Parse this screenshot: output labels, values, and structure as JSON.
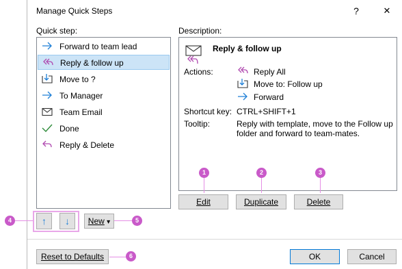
{
  "window": {
    "title": "Manage Quick Steps",
    "help_glyph": "?",
    "close_glyph": "✕"
  },
  "left": {
    "label": "Quick step:",
    "items": [
      {
        "label": "Forward to team lead",
        "icon": "forward-arrow-icon"
      },
      {
        "label": "Reply & follow up",
        "icon": "reply-all-icon",
        "selected": true
      },
      {
        "label": "Move to ?",
        "icon": "move-to-folder-icon"
      },
      {
        "label": "To Manager",
        "icon": "forward-arrow-icon"
      },
      {
        "label": "Team Email",
        "icon": "envelope-icon"
      },
      {
        "label": "Done",
        "icon": "checkmark-icon"
      },
      {
        "label": "Reply & Delete",
        "icon": "reply-icon"
      }
    ]
  },
  "description": {
    "label": "Description:",
    "heading": "Reply & follow up",
    "actions_label": "Actions:",
    "actions": [
      {
        "label": "Reply All",
        "icon": "reply-all-icon"
      },
      {
        "label": "Move to: Follow up",
        "icon": "move-to-folder-icon"
      },
      {
        "label": "Forward",
        "icon": "forward-arrow-icon"
      }
    ],
    "shortcut_label": "Shortcut key:",
    "shortcut_value": "CTRL+SHIFT+1",
    "tooltip_label": "Tooltip:",
    "tooltip_line1": "Reply with template, move to the Follow up",
    "tooltip_line2": "folder and forward to team-mates."
  },
  "buttons": {
    "edit": "Edit",
    "duplicate": "Duplicate",
    "delete": "Delete",
    "up": "↑",
    "down": "↓",
    "new": "New",
    "new_caret": "▾",
    "reset": "Reset to Defaults",
    "ok": "OK",
    "cancel": "Cancel"
  },
  "callouts": [
    "1",
    "2",
    "3",
    "4",
    "5",
    "6"
  ],
  "colors": {
    "accent_blue": "#0078d7",
    "selection": "#cce4f7",
    "callout_magenta": "#c95ac9",
    "icon_purple": "#b04ab0",
    "icon_blue": "#1e7fd6",
    "icon_green": "#2e8b3a"
  }
}
